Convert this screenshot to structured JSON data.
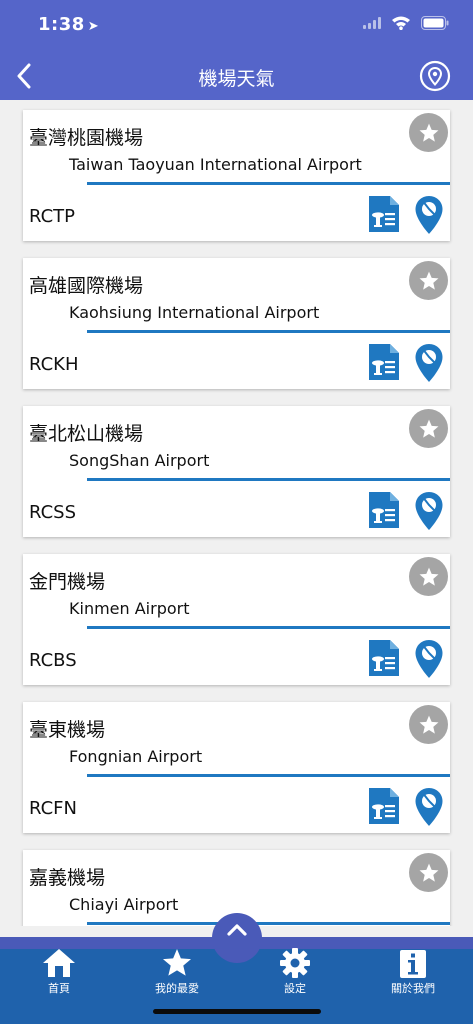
{
  "status_bar": {
    "time": "1:38"
  },
  "nav": {
    "title": "機場天氣"
  },
  "airports": [
    {
      "name": "臺灣桃園機場",
      "english": "Taiwan Taoyuan International Airport",
      "code": "RCTP"
    },
    {
      "name": "高雄國際機場",
      "english": "Kaohsiung International Airport",
      "code": "RCKH"
    },
    {
      "name": "臺北松山機場",
      "english": "SongShan Airport",
      "code": "RCSS"
    },
    {
      "name": "金門機場",
      "english": "Kinmen Airport",
      "code": "RCBS"
    },
    {
      "name": "臺東機場",
      "english": "Fongnian Airport",
      "code": "RCFN"
    },
    {
      "name": "嘉義機場",
      "english": "Chiayi Airport",
      "code": ""
    }
  ],
  "tabbar": {
    "tabs": [
      {
        "label": "首頁",
        "icon": "home-icon"
      },
      {
        "label": "我的最愛",
        "icon": "star-icon"
      },
      {
        "label": "設定",
        "icon": "gear-icon"
      },
      {
        "label": "關於我們",
        "icon": "info-icon"
      }
    ]
  },
  "colors": {
    "header": "#5565c9",
    "tabbar": "#1f62ac",
    "accent": "#1f78c1",
    "star_button": "#a5a5a5"
  }
}
